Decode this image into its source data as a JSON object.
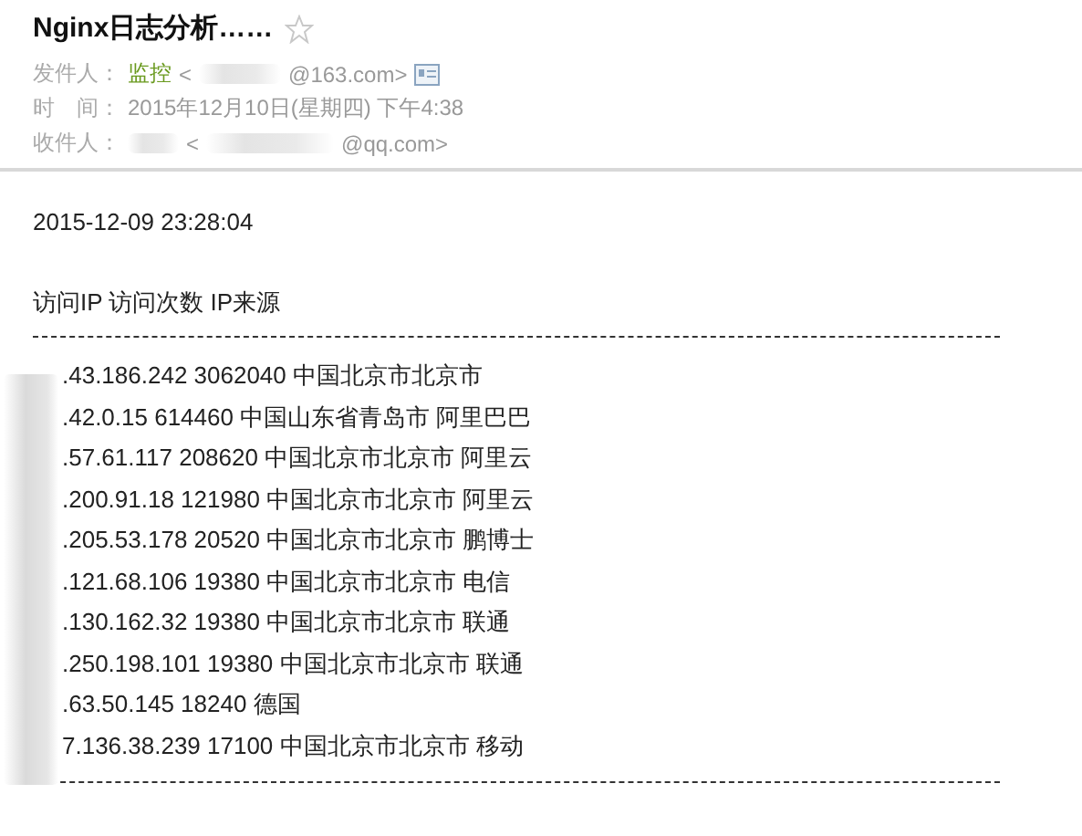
{
  "subject": "Nginx日志分析……",
  "starred": false,
  "sender": {
    "label": "发件人：",
    "name": "监控",
    "open": "<",
    "address": "@163.com>"
  },
  "time": {
    "label": "时　间：",
    "value": "2015年12月10日(星期四) 下午4:38"
  },
  "recipient": {
    "label": "收件人：",
    "open": "<",
    "address": "@qq.com>"
  },
  "body": {
    "timestamp": "2015-12-09 23:28:04",
    "heading": "访问IP 访问次数 IP来源",
    "rows": [
      ".43.186.242 3062040 中国北京市北京市",
      ".42.0.15 614460 中国山东省青岛市 阿里巴巴",
      ".57.61.117 208620 中国北京市北京市 阿里云",
      ".200.91.18 121980 中国北京市北京市 阿里云",
      ".205.53.178 20520 中国北京市北京市 鹏博士",
      ".121.68.106 19380 中国北京市北京市 电信",
      ".130.162.32 19380 中国北京市北京市 联通",
      ".250.198.101 19380 中国北京市北京市 联通",
      ".63.50.145 18240 德国",
      "7.136.38.239 17100 中国北京市北京市 移动"
    ]
  }
}
